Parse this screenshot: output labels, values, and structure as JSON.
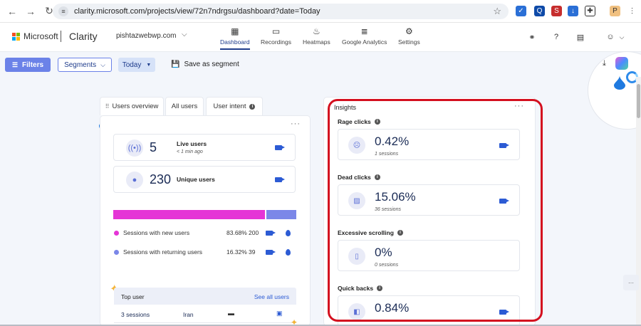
{
  "browser": {
    "url": "clarity.microsoft.com/projects/view/72n7ndrgsu/dashboard?date=Today"
  },
  "header": {
    "ms_brand": "Microsoft",
    "app_name": "Clarity",
    "project": "pishtazwebwp.com",
    "nav": [
      {
        "label": "Dashboard"
      },
      {
        "label": "Recordings"
      },
      {
        "label": "Heatmaps"
      },
      {
        "label": "Google Analytics"
      },
      {
        "label": "Settings"
      }
    ]
  },
  "toolbar": {
    "filters": "Filters",
    "segments": "Segments",
    "today": "Today",
    "save_segment": "Save as segment"
  },
  "users_card": {
    "tabs": [
      "Users overview",
      "All users",
      "User intent"
    ],
    "live": {
      "value": "5",
      "label": "Live users",
      "sub": "< 1 min ago"
    },
    "unique": {
      "value": "230",
      "label": "Unique users"
    },
    "bar": {
      "new_fraction": 0.8368,
      "colors": {
        "new": "#e535d6",
        "returning": "#7b87e8"
      }
    },
    "sessions": [
      {
        "label": "Sessions with new users",
        "pct": "83.68%",
        "count": "200",
        "color": "#e535d6"
      },
      {
        "label": "Sessions with returning users",
        "pct": "16.32%",
        "count": "39",
        "color": "#7b87e8"
      }
    ],
    "top_user": {
      "title": "Top user",
      "link": "See all users",
      "row": {
        "sessions": "3 sessions",
        "country": "Iran"
      }
    }
  },
  "insights": {
    "title": "Insights",
    "items": [
      {
        "label": "Rage clicks",
        "value": "0.42%",
        "sub": "1 sessions"
      },
      {
        "label": "Dead clicks",
        "value": "15.06%",
        "sub": "36 sessions"
      },
      {
        "label": "Excessive scrolling",
        "value": "0%",
        "sub": "0 sessions"
      },
      {
        "label": "Quick backs",
        "value": "0.84%",
        "sub": ""
      }
    ]
  },
  "colors": {
    "accent": "#6b82e8",
    "highlight": "#d4101f",
    "brand_blue": "#1f3d8c"
  }
}
